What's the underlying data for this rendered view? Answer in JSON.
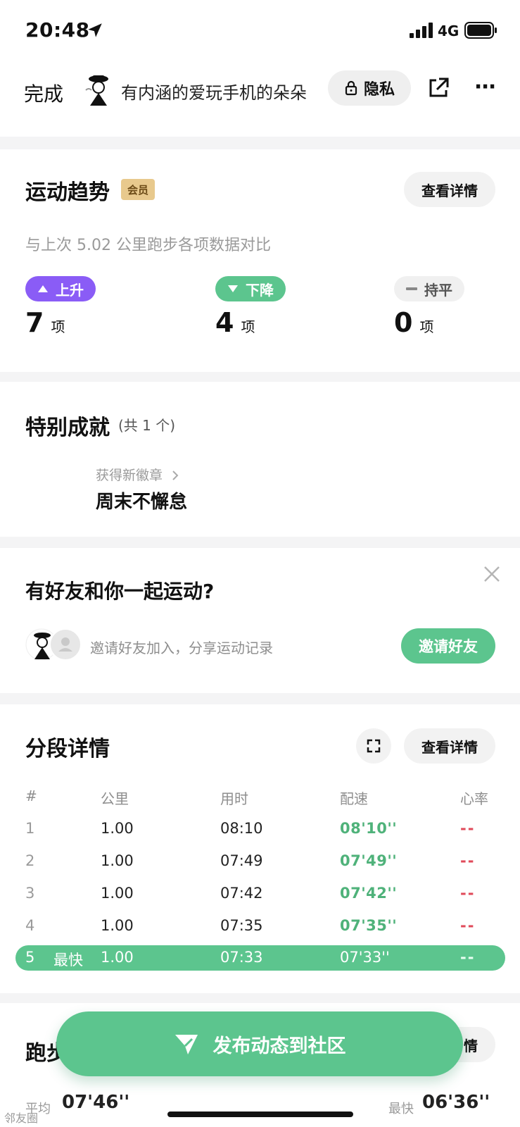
{
  "status_bar": {
    "time": "20:48",
    "network": "4G"
  },
  "header": {
    "done_label": "完成",
    "user_name": "有内涵的爱玩手机的朵朵",
    "privacy_label": "隐私"
  },
  "trend": {
    "title": "运动趋势",
    "vip_badge": "会员",
    "detail_button": "查看详情",
    "subtitle": "与上次 5.02 公里跑步各项数据对比",
    "up": {
      "label": "上升",
      "count": "7",
      "unit": "项"
    },
    "down": {
      "label": "下降",
      "count": "4",
      "unit": "项"
    },
    "flat": {
      "label": "持平",
      "count": "0",
      "unit": "项"
    }
  },
  "achievements": {
    "title": "特别成就",
    "count_text": "(共 1 个)",
    "link_text": "获得新徽章",
    "badge_name": "周末不懈怠"
  },
  "friends": {
    "title": "有好友和你一起运动?",
    "invite_text": "邀请好友加入，分享运动记录",
    "invite_button": "邀请好友"
  },
  "splits": {
    "title": "分段详情",
    "detail_button": "查看详情",
    "columns": [
      "#",
      "公里",
      "用时",
      "配速",
      "心率"
    ],
    "rows": [
      {
        "idx": "1",
        "km": "1.00",
        "time": "08:10",
        "pace": "08'10''",
        "hr": "--"
      },
      {
        "idx": "2",
        "km": "1.00",
        "time": "07:49",
        "pace": "07'49''",
        "hr": "--"
      },
      {
        "idx": "3",
        "km": "1.00",
        "time": "07:42",
        "pace": "07'42''",
        "hr": "--"
      },
      {
        "idx": "4",
        "km": "1.00",
        "time": "07:35",
        "pace": "07'35''",
        "hr": "--"
      }
    ],
    "best_row": {
      "idx": "5",
      "tag": "最快",
      "km": "1.00",
      "time": "07:33",
      "pace": "07'33''",
      "hr": "--"
    }
  },
  "pace_card": {
    "title": "跑步",
    "detail_button": "情",
    "avg_label": "平均",
    "avg_value": "07'46''",
    "fast_label": "最快",
    "fast_value": "06'36''"
  },
  "publish_button": "发布动态到社区",
  "watermark": "邻友圈",
  "colors": {
    "accent_green": "#5cc58e",
    "up_purple": "#8a5cf6",
    "vip_gold": "#e8c98d"
  },
  "icons": [
    "location-arrow-icon",
    "signal-icon",
    "battery-icon",
    "lock-icon",
    "share-icon",
    "more-icon",
    "triangle-up-icon",
    "triangle-down-icon",
    "dash-icon",
    "chevron-right-icon",
    "close-icon",
    "person-icon",
    "fullscreen-icon",
    "send-icon"
  ]
}
